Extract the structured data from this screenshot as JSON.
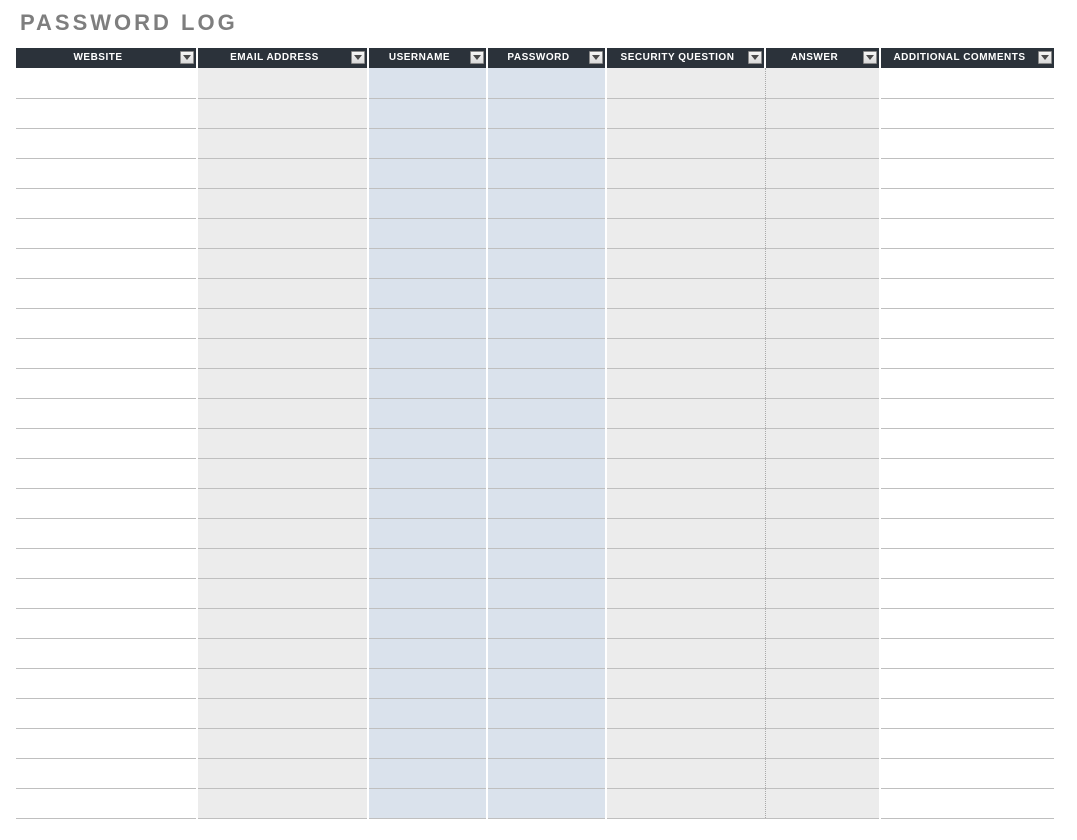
{
  "title": "PASSWORD LOG",
  "columns": [
    {
      "label": "WEBSITE"
    },
    {
      "label": "EMAIL ADDRESS"
    },
    {
      "label": "USERNAME"
    },
    {
      "label": "PASSWORD"
    },
    {
      "label": "SECURITY QUESTION"
    },
    {
      "label": "ANSWER"
    },
    {
      "label": "ADDITIONAL COMMENTS"
    }
  ],
  "rows": [
    [
      "",
      "",
      "",
      "",
      "",
      "",
      ""
    ],
    [
      "",
      "",
      "",
      "",
      "",
      "",
      ""
    ],
    [
      "",
      "",
      "",
      "",
      "",
      "",
      ""
    ],
    [
      "",
      "",
      "",
      "",
      "",
      "",
      ""
    ],
    [
      "",
      "",
      "",
      "",
      "",
      "",
      ""
    ],
    [
      "",
      "",
      "",
      "",
      "",
      "",
      ""
    ],
    [
      "",
      "",
      "",
      "",
      "",
      "",
      ""
    ],
    [
      "",
      "",
      "",
      "",
      "",
      "",
      ""
    ],
    [
      "",
      "",
      "",
      "",
      "",
      "",
      ""
    ],
    [
      "",
      "",
      "",
      "",
      "",
      "",
      ""
    ],
    [
      "",
      "",
      "",
      "",
      "",
      "",
      ""
    ],
    [
      "",
      "",
      "",
      "",
      "",
      "",
      ""
    ],
    [
      "",
      "",
      "",
      "",
      "",
      "",
      ""
    ],
    [
      "",
      "",
      "",
      "",
      "",
      "",
      ""
    ],
    [
      "",
      "",
      "",
      "",
      "",
      "",
      ""
    ],
    [
      "",
      "",
      "",
      "",
      "",
      "",
      ""
    ],
    [
      "",
      "",
      "",
      "",
      "",
      "",
      ""
    ],
    [
      "",
      "",
      "",
      "",
      "",
      "",
      ""
    ],
    [
      "",
      "",
      "",
      "",
      "",
      "",
      ""
    ],
    [
      "",
      "",
      "",
      "",
      "",
      "",
      ""
    ],
    [
      "",
      "",
      "",
      "",
      "",
      "",
      ""
    ],
    [
      "",
      "",
      "",
      "",
      "",
      "",
      ""
    ],
    [
      "",
      "",
      "",
      "",
      "",
      "",
      ""
    ],
    [
      "",
      "",
      "",
      "",
      "",
      "",
      ""
    ],
    [
      "",
      "",
      "",
      "",
      "",
      "",
      ""
    ]
  ]
}
